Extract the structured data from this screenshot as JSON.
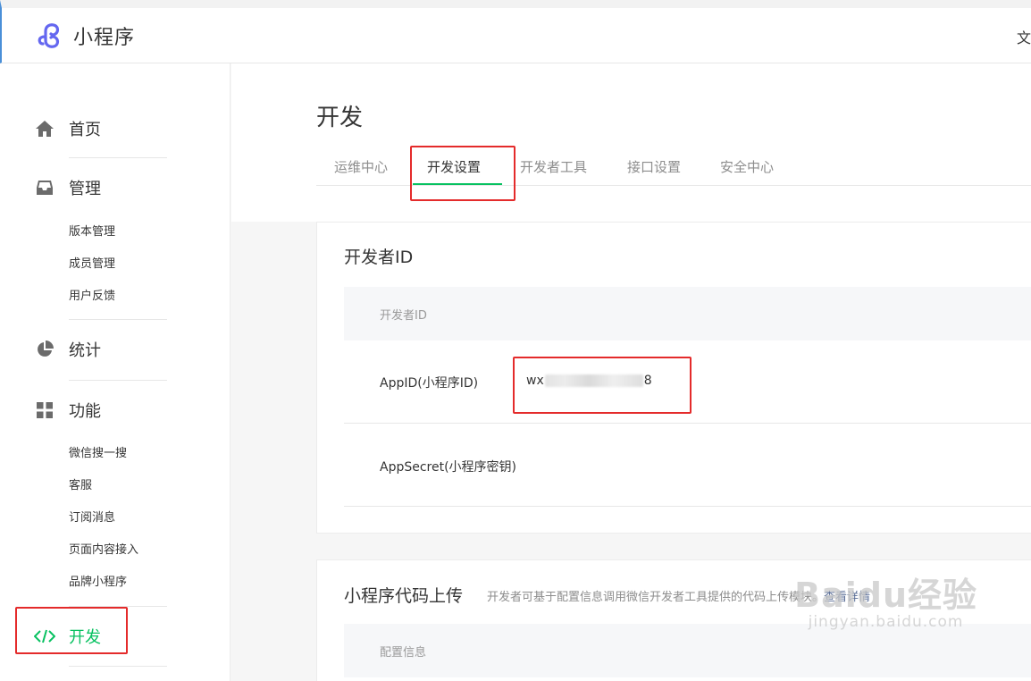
{
  "app": {
    "name": "小程序",
    "top_right": "文"
  },
  "sidebar": {
    "home": "首页",
    "manage": "管理",
    "manage_items": [
      "版本管理",
      "成员管理",
      "用户反馈"
    ],
    "stats": "统计",
    "features": "功能",
    "feature_items": [
      "微信搜一搜",
      "客服",
      "订阅消息",
      "页面内容接入",
      "品牌小程序"
    ],
    "develop": "开发"
  },
  "page": {
    "title": "开发",
    "tabs": [
      "运维中心",
      "开发设置",
      "开发者工具",
      "接口设置",
      "安全中心"
    ],
    "active_tab": "开发设置"
  },
  "developer_id": {
    "section_title": "开发者ID",
    "table_header": "开发者ID",
    "appid_label": "AppID(小程序ID)",
    "appid_prefix": "wx",
    "appid_suffix": "8",
    "appsecret_label": "AppSecret(小程序密钥)"
  },
  "code_upload": {
    "section_title": "小程序代码上传",
    "hint": "开发者可基于配置信息调用微信开发者工具提供的代码上传模块。",
    "hint_link": "查看详情",
    "table_header": "配置信息"
  },
  "watermark": {
    "logo": "Baidu经验",
    "url": "jingyan.baidu.com"
  },
  "colors": {
    "accent_green": "#07c160",
    "highlight_red": "#e42b2b",
    "link_blue": "#576b95"
  }
}
